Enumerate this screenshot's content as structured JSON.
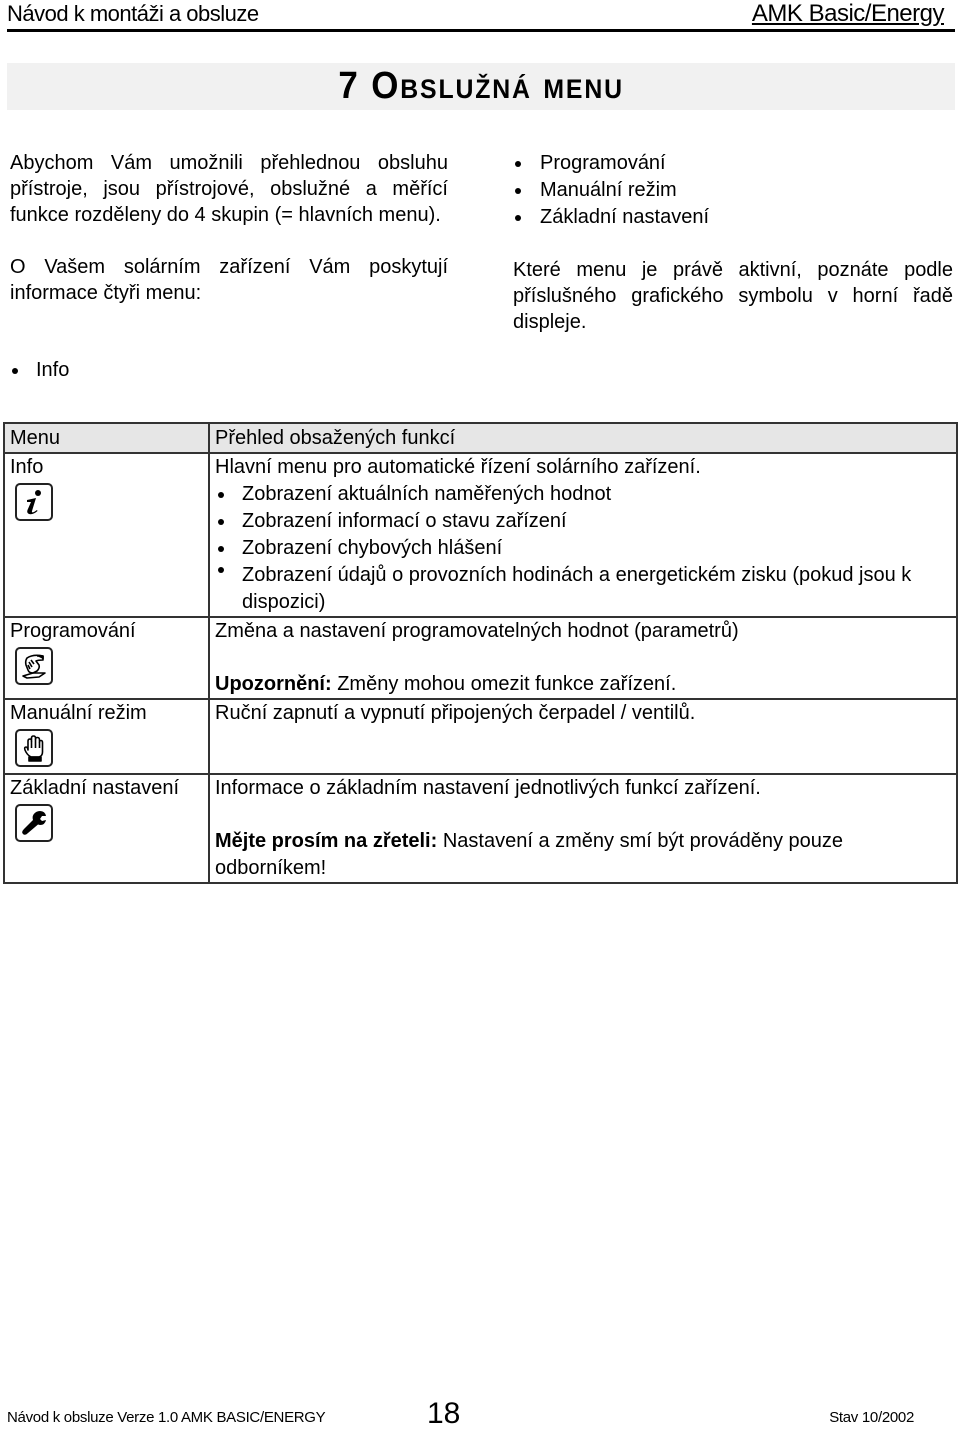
{
  "header": {
    "left": "Návod k montáži a obsluze",
    "right": "AMK Basic/Energy"
  },
  "title": "7 Obslužná menu",
  "intro": {
    "paragraph1": "Abychom Vám umožnili přehlednou obsluhu přístroje, jsou přístrojové, obslužné a měřící funkce rozděleny do 4 skupin (= hlavních menu).",
    "paragraph2": "O Vašem solárním zařízení Vám poskytují informace čtyři menu:",
    "menu_list": [
      "Info",
      "Programování",
      "Manuální režim",
      "Základní nastavení"
    ],
    "paragraph3": "Které menu je právě aktivní, poznáte podle příslušného grafického symbolu v horní řadě displeje."
  },
  "table": {
    "headers": [
      "Menu",
      "Přehled obsažených funkcí"
    ],
    "rows": [
      {
        "menu": "Info",
        "icon": "info-icon",
        "description": "Hlavní menu pro automatické řízení solárního zařízení.",
        "bullets": [
          "Zobrazení aktuálních naměřených hodnot",
          "Zobrazení informací o stavu zařízení",
          "Zobrazení chybových hlášení",
          "Zobrazení údajů o provozních hodinách a energetickém zisku (pokud jsou k dispozici)"
        ]
      },
      {
        "menu": "Programování",
        "icon": "programming-hand-icon",
        "description": "Změna a nastavení programovatelných hodnot (parametrů)",
        "note_label": "Upozornění:",
        "note_text": " Změny mohou omezit funkce zařízení."
      },
      {
        "menu": "Manuální režim",
        "icon": "manual-hand-icon",
        "description": "Ruční zapnutí a vypnutí připojených čerpadel / ventilů."
      },
      {
        "menu": "Základní nastavení",
        "icon": "wrench-icon",
        "description": "Informace o základním nastavení jednotlivých funkcí zařízení.",
        "note_label": "Mějte prosím na zřeteli:",
        "note_text": " Nastavení a změny smí být prováděny pouze odborníkem!"
      }
    ]
  },
  "footer": {
    "left": "Návod k obsluze Verze 1.0 AMK BASIC/ENERGY",
    "page": "18",
    "right": "Stav 10/2002"
  }
}
